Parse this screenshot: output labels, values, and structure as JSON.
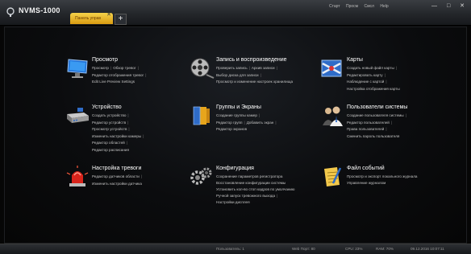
{
  "app": {
    "title": "NVMS-1000",
    "tab_label": "Панель управ",
    "tab_close": "✕",
    "add_tab": "+",
    "menu": [
      "Старт",
      "Просм",
      "Смсл",
      "Help"
    ],
    "window_controls": [
      "—",
      "□",
      "✕"
    ]
  },
  "modules": [
    {
      "title": "Просмотр",
      "icon": "monitor-icon",
      "lines": [
        [
          "Просмотр",
          "Обзор тревог"
        ],
        [
          "Редактор отображения тревог"
        ],
        [
          "Edit Live Preview Settings"
        ]
      ]
    },
    {
      "title": "Запись и воспроизведение",
      "icon": "film-reel-icon",
      "lines": [
        [
          "Проверить запись",
          "Архив записи"
        ],
        [
          "Выбор диска для записи"
        ],
        [
          "Просмотр и изменение настроек хранилища"
        ]
      ]
    },
    {
      "title": "Карты",
      "icon": "map-icon",
      "lines": [
        [
          "Создать новый файл карты"
        ],
        [
          "Редактировать карту"
        ],
        [
          "Наблюдение с картой"
        ],
        [
          "Настройка отображения карты"
        ]
      ]
    },
    {
      "title": "Устройство",
      "icon": "nvr-device-icon",
      "lines": [
        [
          "Создать устройство"
        ],
        [
          "Редактор устройств"
        ],
        [
          "Просмотр устройств"
        ],
        [
          "Изменить настройки камеры"
        ],
        [
          "Редактор областей"
        ],
        [
          "Редактор расписания"
        ]
      ]
    },
    {
      "title": "Группы и Экраны",
      "icon": "book-icon",
      "lines": [
        [
          "Создание группы камер"
        ],
        [
          "Редактор групп",
          "Добавить экран"
        ],
        [
          "Редактор экранов"
        ]
      ]
    },
    {
      "title": "Пользователи системы",
      "icon": "users-icon",
      "lines": [
        [
          "Создание пользователя системы"
        ],
        [
          "Редактор пользователей"
        ],
        [
          "Права пользователей"
        ],
        [
          "Сменить пароль пользователя"
        ]
      ]
    },
    {
      "title": "Настройка тревоги",
      "icon": "alarm-siren-icon",
      "lines": [
        [
          "Редактор датчиков области"
        ],
        [
          "Изменить настройки датчика"
        ]
      ]
    },
    {
      "title": "Конфигурация",
      "icon": "gears-icon",
      "lines": [
        [
          "Сохранение параметров регистратора"
        ],
        [
          "Восстановление конфигурации системы"
        ],
        [
          "Установить кол-во стоп кадров по умолчанию"
        ],
        [
          "Ручной запуск тревожного выхода"
        ],
        [
          "Настройки дисплея"
        ]
      ]
    },
    {
      "title": "Файл событий",
      "icon": "notepad-icon",
      "lines": [
        [
          "Просмотр и экспорт локального журнала"
        ],
        [
          "Управление журналом"
        ]
      ]
    }
  ],
  "status": {
    "users": "Пользователь: 1",
    "web_port": "Web Порт: 80",
    "cpu": "CPU: 23%",
    "ram": "RAM: 70%",
    "datetime": "09.12.2016 10:07:11"
  },
  "colors": {
    "tab_gold": "#e8b82a",
    "background": "#060606",
    "title_text": "#ffffff",
    "link_text": "#c4c4c4"
  }
}
